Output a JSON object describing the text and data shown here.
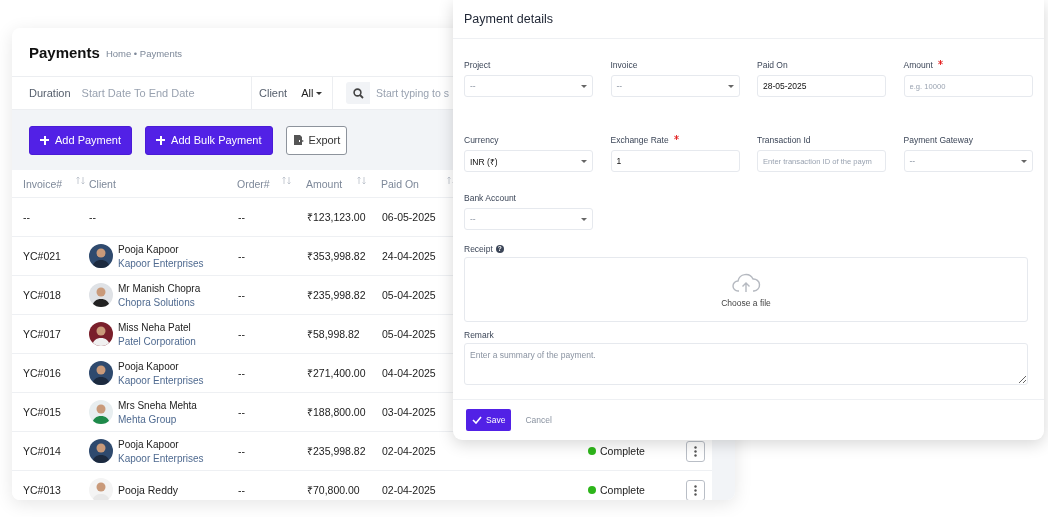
{
  "page": {
    "title": "Payments",
    "breadcrumb": "Home • Payments"
  },
  "filters": {
    "duration_label": "Duration",
    "duration_placeholder": "Start Date To End Date",
    "client_label": "Client",
    "client_value": "All",
    "search_placeholder": "Start typing to s"
  },
  "actions": [
    {
      "label": "Add Payment",
      "kind": "primary"
    },
    {
      "label": "Add Bulk Payment",
      "kind": "primary"
    },
    {
      "label": "Export",
      "kind": "outline"
    }
  ],
  "table": {
    "columns": [
      {
        "label": "Invoice#",
        "sortable": true
      },
      {
        "label": "Client",
        "sortable": false
      },
      {
        "label": "Order#",
        "sortable": true
      },
      {
        "label": "Amount",
        "sortable": true
      },
      {
        "label": "Paid On",
        "sortable": true
      }
    ],
    "rows": [
      {
        "invoice": "--",
        "client": {
          "name": "--"
        },
        "order": "--",
        "amount": "₹123,123.00",
        "paid_on": "06-05-2025"
      },
      {
        "invoice": "YC#021",
        "client": {
          "name": "Pooja Kapoor",
          "company": "Kapoor Enterprises"
        },
        "order": "--",
        "amount": "₹353,998.82",
        "paid_on": "24-04-2025"
      },
      {
        "invoice": "YC#018",
        "client": {
          "name": "Mr Manish Chopra",
          "company": "Chopra Solutions"
        },
        "order": "--",
        "amount": "₹235,998.82",
        "paid_on": "05-04-2025"
      },
      {
        "invoice": "YC#017",
        "client": {
          "name": "Miss Neha Patel",
          "company": "Patel Corporation"
        },
        "order": "--",
        "amount": "₹58,998.82",
        "paid_on": "05-04-2025"
      },
      {
        "invoice": "YC#016",
        "client": {
          "name": "Pooja Kapoor",
          "company": "Kapoor Enterprises"
        },
        "order": "--",
        "amount": "₹271,400.00",
        "paid_on": "04-04-2025"
      },
      {
        "invoice": "YC#015",
        "client": {
          "name": "Mrs Sneha Mehta",
          "company": "Mehta Group"
        },
        "order": "--",
        "amount": "₹188,800.00",
        "paid_on": "03-04-2025"
      },
      {
        "invoice": "YC#014",
        "client": {
          "name": "Pooja Kapoor",
          "company": "Kapoor Enterprises"
        },
        "order": "--",
        "amount": "₹235,998.82",
        "paid_on": "02-04-2025",
        "status": {
          "label": "Complete",
          "color": "#2db51a"
        },
        "menu": true
      },
      {
        "invoice": "YC#013",
        "client": {
          "name": "Pooja Reddy"
        },
        "order": "--",
        "amount": "₹70,800.00",
        "paid_on": "02-04-2025",
        "status": {
          "label": "Complete",
          "color": "#2db51a"
        },
        "menu": true
      }
    ]
  },
  "modal": {
    "title": "Payment details",
    "fields": [
      {
        "label": "Project",
        "kind": "select",
        "value": "--",
        "required": false
      },
      {
        "label": "Invoice",
        "kind": "select",
        "value": "--",
        "required": false
      },
      {
        "label": "Paid On",
        "kind": "input",
        "value": "28-05-2025",
        "required": false
      },
      {
        "label": "Amount",
        "kind": "input",
        "placeholder": "e.g. 10000",
        "required": true
      },
      {
        "label": "Currency",
        "kind": "select",
        "value": "INR (₹)",
        "required": false
      },
      {
        "label": "Exchange Rate",
        "kind": "input",
        "value": "1",
        "required": true
      },
      {
        "label": "Transaction Id",
        "kind": "input",
        "placeholder": "Enter transaction ID of the paym",
        "required": false
      },
      {
        "label": "Payment Gateway",
        "kind": "select",
        "value": "--",
        "required": false
      },
      {
        "label": "Bank Account",
        "kind": "select",
        "value": "--",
        "required": false
      }
    ],
    "receipt": {
      "label": "Receipt",
      "help": "?",
      "prompt": "Choose a file"
    },
    "remark": {
      "label": "Remark",
      "placeholder": "Enter a summary of the payment."
    },
    "buttons": [
      {
        "label": "Save",
        "kind": "primary"
      },
      {
        "label": "Cancel",
        "kind": "link"
      }
    ]
  }
}
